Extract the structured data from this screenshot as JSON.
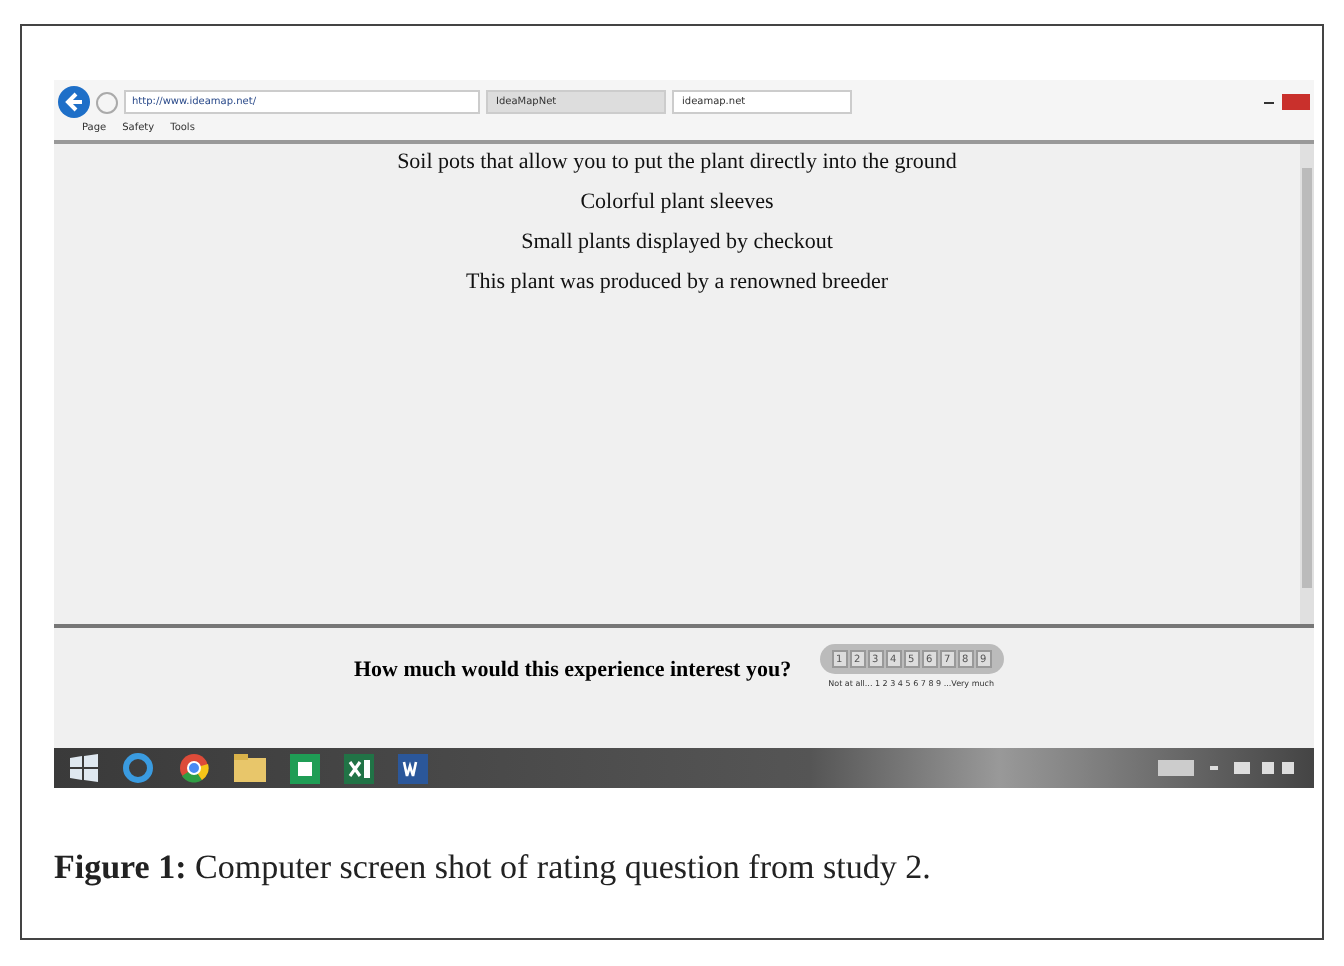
{
  "browser": {
    "address": "http://www.ideamap.net/",
    "tabs": [
      {
        "label": "IdeaMapNet",
        "selected": false
      },
      {
        "label": "ideamap.net",
        "selected": true
      }
    ],
    "toolbar": [
      "Page",
      "Safety",
      "Tools"
    ]
  },
  "content": {
    "statements": [
      "Soil pots that allow you to put the plant directly into the ground",
      "Colorful plant sleeves",
      "Small plants displayed by checkout",
      "This plant was produced by a renowned breeder"
    ],
    "question": "How much would this experience interest you?",
    "ratings": [
      "1",
      "2",
      "3",
      "4",
      "5",
      "6",
      "7",
      "8",
      "9"
    ],
    "scale_label": "Not at all... 1 2 3 4 5 6 7 8 9 ...Very much"
  },
  "caption": {
    "label": "Figure 1:",
    "text": "Computer screen shot of rating question from study 2."
  }
}
